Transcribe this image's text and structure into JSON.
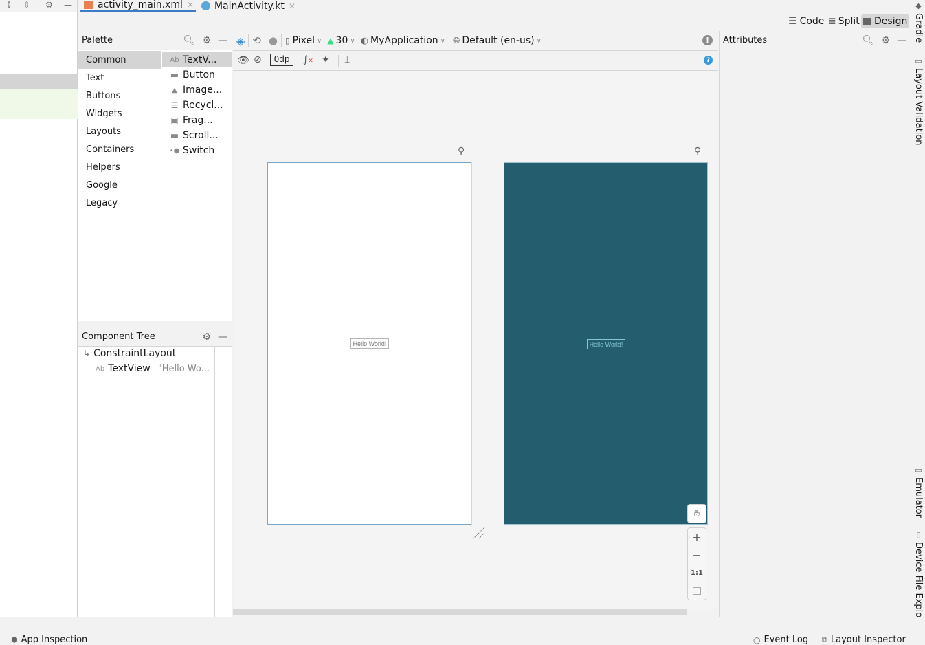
{
  "editor_tabs": [
    {
      "label": "activity_main.xml",
      "icon": "xml-layout-icon",
      "active": true
    },
    {
      "label": "MainActivity.kt",
      "icon": "kotlin-class-icon",
      "active": false
    }
  ],
  "view_modes": {
    "code": "Code",
    "split": "Split",
    "design": "Design",
    "active": "Design"
  },
  "palette": {
    "title": "Palette",
    "categories": [
      "Common",
      "Text",
      "Buttons",
      "Widgets",
      "Layouts",
      "Containers",
      "Helpers",
      "Google",
      "Legacy"
    ],
    "selected_category": "Common",
    "items": [
      {
        "label": "TextV...",
        "icon": "textview-icon",
        "glyph": "Ab"
      },
      {
        "label": "Button",
        "icon": "button-icon",
        "glyph": "▬"
      },
      {
        "label": "Image...",
        "icon": "image-icon",
        "glyph": "▲"
      },
      {
        "label": "Recycl...",
        "icon": "list-icon",
        "glyph": "☰"
      },
      {
        "label": "Frag...",
        "icon": "fragment-icon",
        "glyph": "▣"
      },
      {
        "label": "Scroll...",
        "icon": "scrollview-icon",
        "glyph": "▬"
      },
      {
        "label": "Switch",
        "icon": "switch-icon",
        "glyph": "•●"
      }
    ]
  },
  "component_tree": {
    "title": "Component Tree",
    "nodes": [
      {
        "label": "ConstraintLayout",
        "icon": "constraint-layout-icon",
        "glyph": "↳"
      },
      {
        "label": "TextView",
        "hint": "\"Hello Wo...",
        "icon": "textview-icon",
        "glyph": "Ab"
      }
    ]
  },
  "toolbar": {
    "device": "Pixel",
    "api": "30",
    "theme": "MyApplication",
    "locale": "Default (en-us)",
    "margin": "0dp"
  },
  "canvas": {
    "hello_text": "Hello World!",
    "zoom_controls": {
      "zoom_in": "+",
      "zoom_out": "−",
      "actual": "1:1"
    },
    "colors": {
      "blueprint": "#235d6e",
      "design": "#ffffff"
    }
  },
  "attributes": {
    "title": "Attributes"
  },
  "right_tools": [
    "Gradle",
    "Layout Validation",
    "Emulator",
    "Device File Explorer"
  ],
  "status_bar": {
    "app_inspection": "App Inspection",
    "event_log": "Event Log",
    "layout_inspector": "Layout Inspector"
  }
}
